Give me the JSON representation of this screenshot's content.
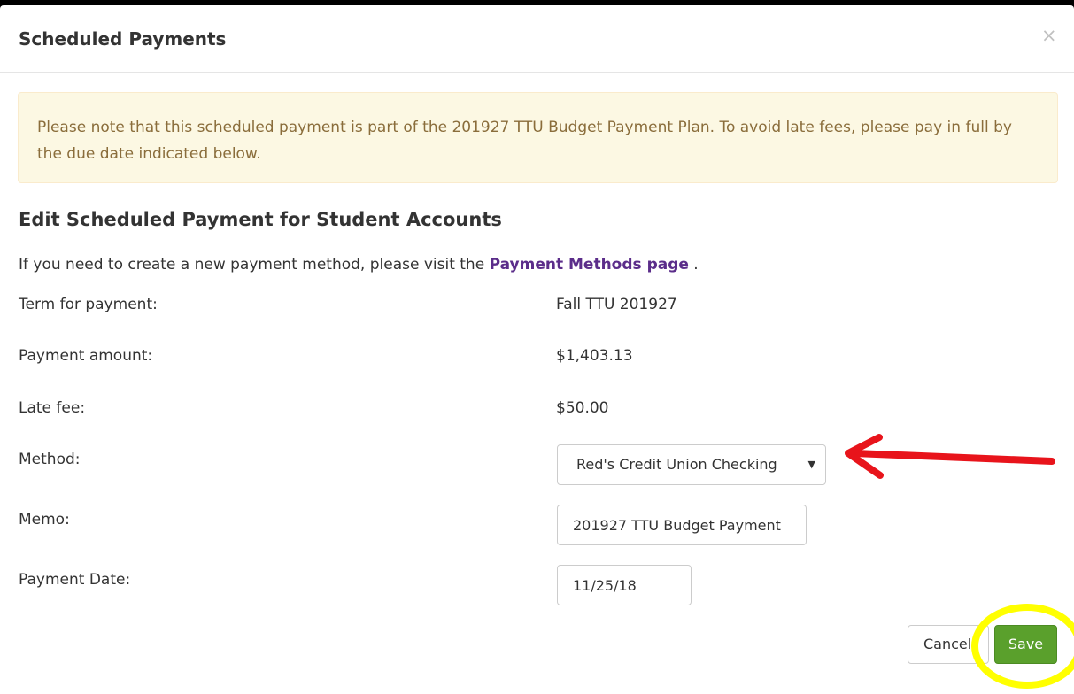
{
  "modal": {
    "title": "Scheduled Payments",
    "close_label": "×"
  },
  "alert": {
    "text": "Please note that this scheduled payment is part of the 201927 TTU Budget Payment Plan.  To avoid late fees, please pay in full by the due date indicated below."
  },
  "form": {
    "heading": "Edit Scheduled Payment for Student Accounts",
    "intro_prefix": "If you need to create a new payment method, please visit the ",
    "intro_link": "Payment Methods page",
    "intro_suffix": " .",
    "term_label": "Term for payment:",
    "term_value": "Fall TTU 201927",
    "amount_label": "Payment amount:",
    "amount_value": "$1,403.13",
    "late_fee_label": "Late fee:",
    "late_fee_value": "$50.00",
    "method_label": "Method:",
    "method_selected": "Red's Credit Union Checking",
    "method_arrow": "▼",
    "memo_label": "Memo:",
    "memo_value": "201927 TTU Budget Payment",
    "date_label": "Payment Date:",
    "date_value": "11/25/18"
  },
  "buttons": {
    "cancel_label": "Cancel",
    "save_label": "Save"
  },
  "annotations": {
    "arrow_color": "#e8141b",
    "circle_color": "#ffff00"
  }
}
